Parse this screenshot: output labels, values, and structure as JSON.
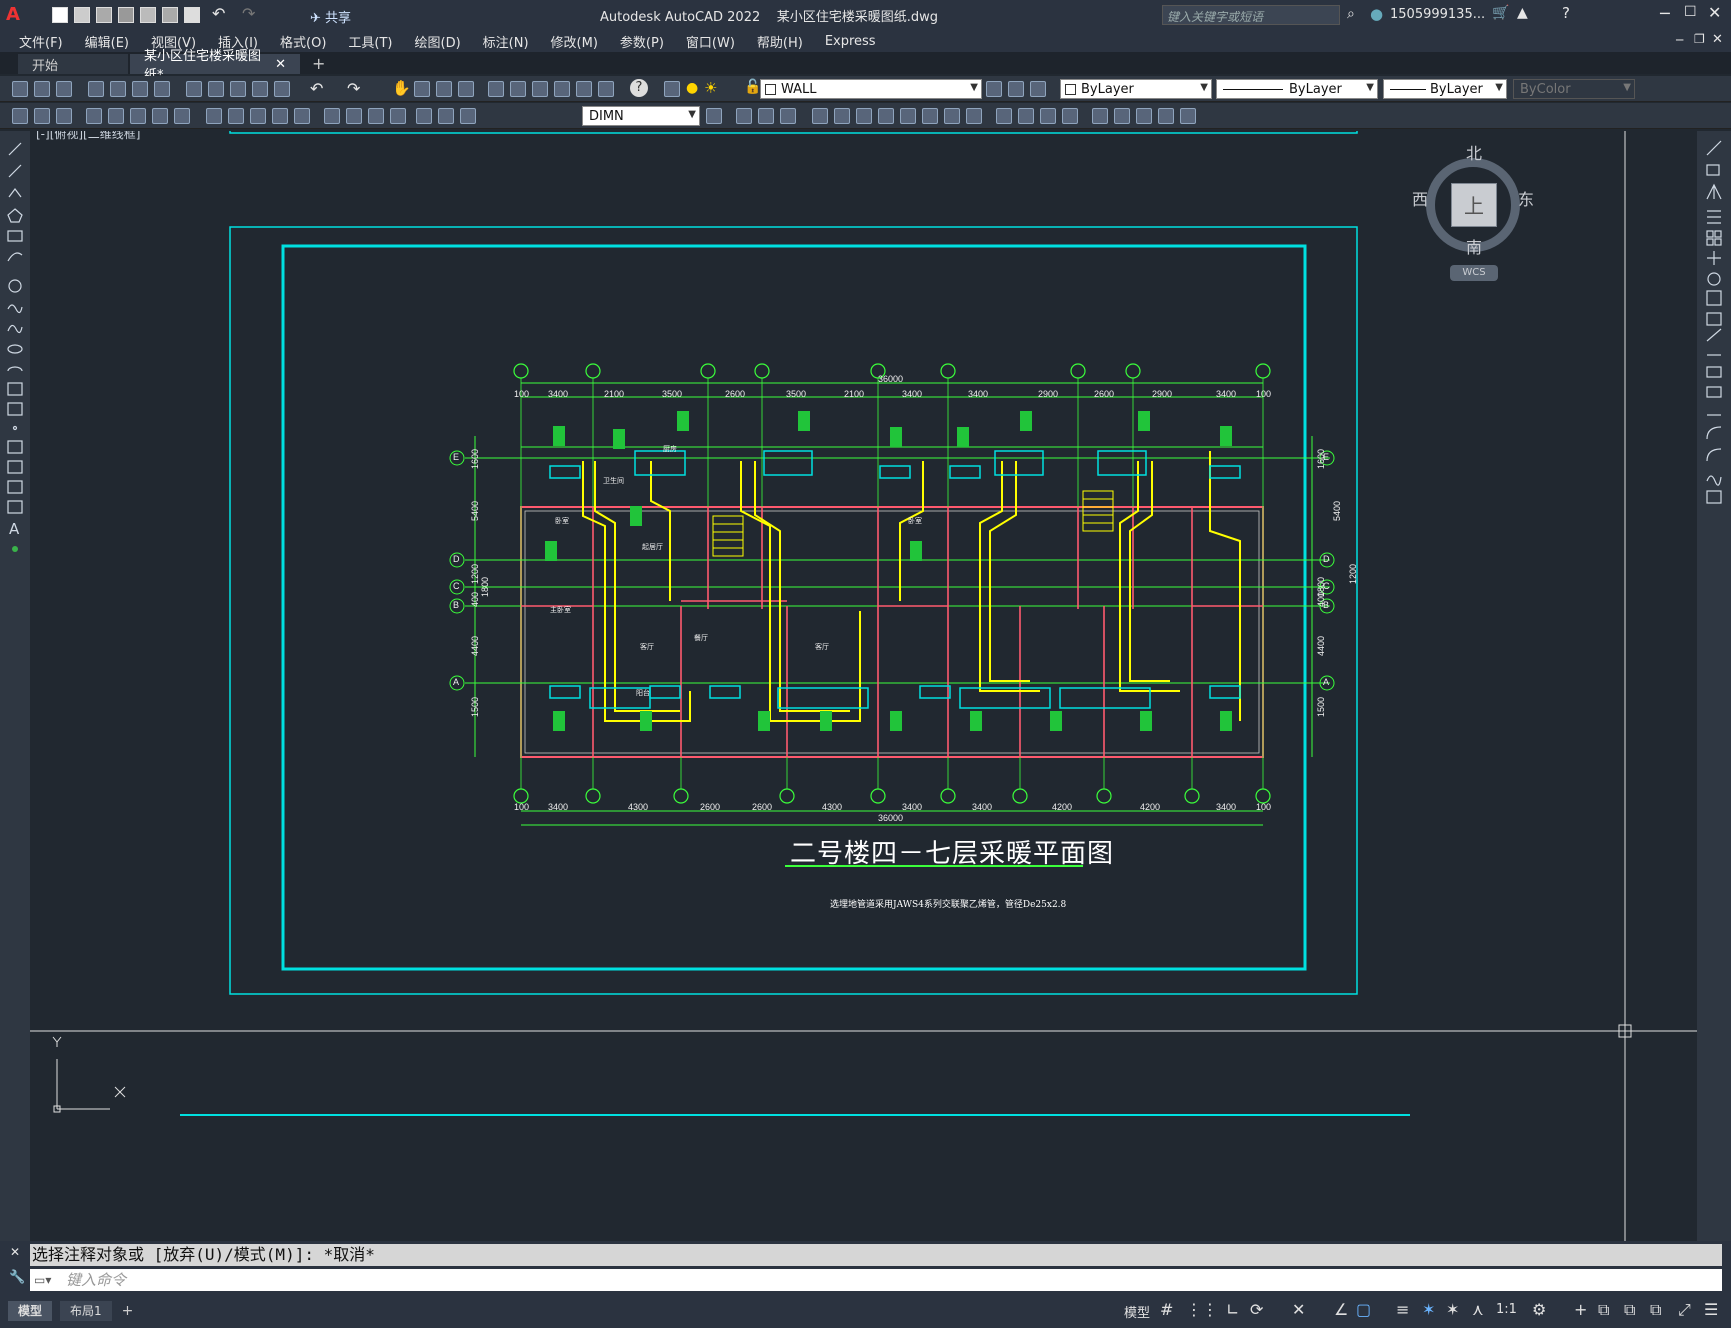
{
  "titlebar": {
    "app_title": "Autodesk AutoCAD 2022",
    "file_title": "某小区住宅楼采暖图纸.dwg",
    "search_placeholder": "键入关键字或短语",
    "user": "1505999135...",
    "share_label": "共享"
  },
  "menu": [
    "文件(F)",
    "编辑(E)",
    "视图(V)",
    "插入(I)",
    "格式(O)",
    "工具(T)",
    "绘图(D)",
    "标注(N)",
    "修改(M)",
    "参数(P)",
    "窗口(W)",
    "帮助(H)",
    "Express"
  ],
  "tabs": [
    {
      "label": "开始",
      "active": false
    },
    {
      "label": "某小区住宅楼采暖图纸*",
      "active": true
    }
  ],
  "toolbar": {
    "layer_value": "WALL",
    "color_value": "ByLayer",
    "linetype_value": "ByLayer",
    "lineweight_value": "ByLayer",
    "plotstyle_value": "ByColor",
    "dimstyle_value": "DIMN"
  },
  "viewport_label": "[-][俯视][二维线框]",
  "viewcube": {
    "north": "北",
    "south": "南",
    "east": "东",
    "west": "西",
    "top": "上",
    "wcs": "WCS"
  },
  "drawing": {
    "title": "二号楼四－七层采暖平面图",
    "note": "选埋地管道采用JAWS4系列交联聚乙烯管，管径De25x2.8",
    "total_dim": "36000",
    "top_dims": [
      "100",
      "3400",
      "2100",
      "3500",
      "2600",
      "3500",
      "2100",
      "3400",
      "3400",
      "2900",
      "2600",
      "2900",
      "3400",
      "100"
    ],
    "bottom_dims": [
      "100",
      "3400",
      "4300",
      "2600",
      "2600",
      "4300",
      "3400",
      "3400",
      "4200",
      "4200",
      "3400",
      "100"
    ],
    "left_dims": [
      "1600",
      "5400",
      "1200",
      "1800",
      "400",
      "4400",
      "1500"
    ],
    "right_dims": [
      "1600",
      "5400",
      "1200",
      "1800",
      "400",
      "4400",
      "1500"
    ],
    "row_axes": [
      "E",
      "D",
      "C",
      "B",
      "A"
    ],
    "rooms": [
      "卧室",
      "厨房",
      "卫生间",
      "起居厅",
      "客厅",
      "主卧室",
      "阳台",
      "餐厅",
      "卧室",
      "客厅"
    ]
  },
  "command": {
    "history": "选择注释对象或 [放弃(U)/模式(M)]: *取消*",
    "placeholder": "键入命令"
  },
  "status": {
    "layout_tabs": [
      "模型",
      "布局1"
    ],
    "model_label": "模型",
    "scale": "1:1"
  }
}
